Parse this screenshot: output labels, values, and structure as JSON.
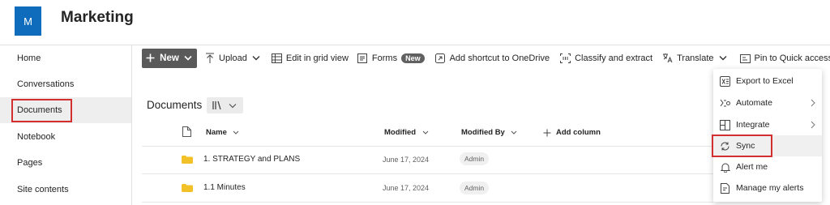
{
  "site": {
    "logo_letter": "M",
    "title": "Marketing"
  },
  "nav": {
    "items": [
      {
        "label": "Home"
      },
      {
        "label": "Conversations"
      },
      {
        "label": "Documents"
      },
      {
        "label": "Notebook"
      },
      {
        "label": "Pages"
      },
      {
        "label": "Site contents"
      }
    ]
  },
  "commandbar": {
    "new_label": "New",
    "upload_label": "Upload",
    "edit_grid_label": "Edit in grid view",
    "forms_label": "Forms",
    "forms_badge": "New",
    "add_shortcut_label": "Add shortcut to OneDrive",
    "classify_label": "Classify and extract",
    "translate_label": "Translate",
    "pin_label": "Pin to Quick access",
    "more_label": "···"
  },
  "library": {
    "title": "Documents",
    "columns": {
      "name": "Name",
      "modified": "Modified",
      "modified_by": "Modified By",
      "add_column": "Add column"
    },
    "rows": [
      {
        "name": "1. STRATEGY and PLANS",
        "modified": "June 17, 2024",
        "modified_by": "Admin"
      },
      {
        "name": "1.1 Minutes",
        "modified": "June 17, 2024",
        "modified_by": "Admin"
      }
    ]
  },
  "menu": {
    "items": [
      {
        "label": "Export to Excel",
        "icon": "excel-icon"
      },
      {
        "label": "Automate",
        "icon": "automate-icon"
      },
      {
        "label": "Integrate",
        "icon": "integrate-icon"
      },
      {
        "label": "Sync",
        "icon": "sync-icon"
      },
      {
        "label": "Alert me",
        "icon": "bell-icon"
      },
      {
        "label": "Manage my alerts",
        "icon": "manage-alerts-icon"
      }
    ]
  },
  "colors": {
    "brand": "#0f6cbd",
    "highlight_box": "#d32f2f",
    "new_button": "#5a5a5a",
    "folder": "#f2c128"
  }
}
